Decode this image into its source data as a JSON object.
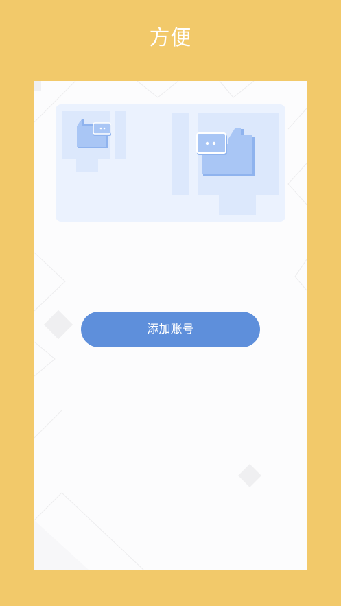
{
  "header": {
    "title": "方便"
  },
  "main": {
    "add_account_label": "添加账号"
  },
  "icons": {
    "chat_small": "chat-bubbles-icon",
    "chat_large": "chat-bubbles-icon"
  },
  "colors": {
    "background": "#F2C96A",
    "button": "#5E8FDB",
    "illustration_bg": "#EBF2FE",
    "icon_blue": "#A9C6F5"
  }
}
